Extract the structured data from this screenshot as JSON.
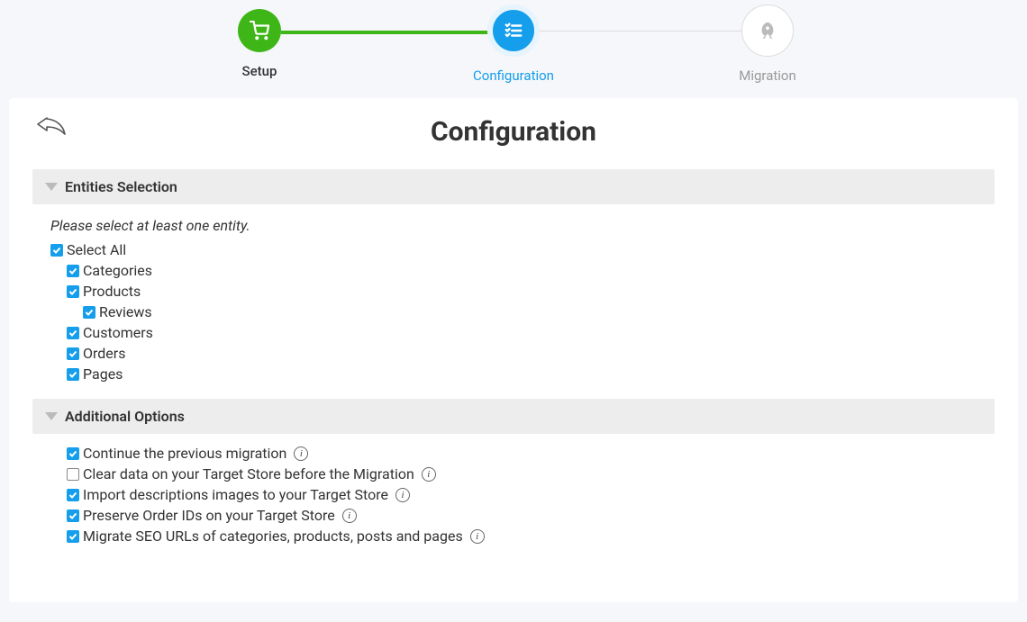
{
  "stepper": {
    "steps": [
      {
        "label": "Setup",
        "state": "done"
      },
      {
        "label": "Configuration",
        "state": "active"
      },
      {
        "label": "Migration",
        "state": "pending"
      }
    ]
  },
  "page": {
    "title": "Configuration"
  },
  "entities": {
    "header": "Entities Selection",
    "hint": "Please select at least one entity.",
    "selectAllLabel": "Select All",
    "items": {
      "categories": "Categories",
      "products": "Products",
      "reviews": "Reviews",
      "customers": "Customers",
      "orders": "Orders",
      "pages": "Pages"
    }
  },
  "options": {
    "header": "Additional Options",
    "items": {
      "continuePrev": "Continue the previous migration",
      "clearTarget": "Clear data on your Target Store before the Migration",
      "importImages": "Import descriptions images to your Target Store",
      "preserveOrderIds": "Preserve Order IDs on your Target Store",
      "migrateSeo": "Migrate SEO URLs of categories, products, posts and pages"
    }
  }
}
